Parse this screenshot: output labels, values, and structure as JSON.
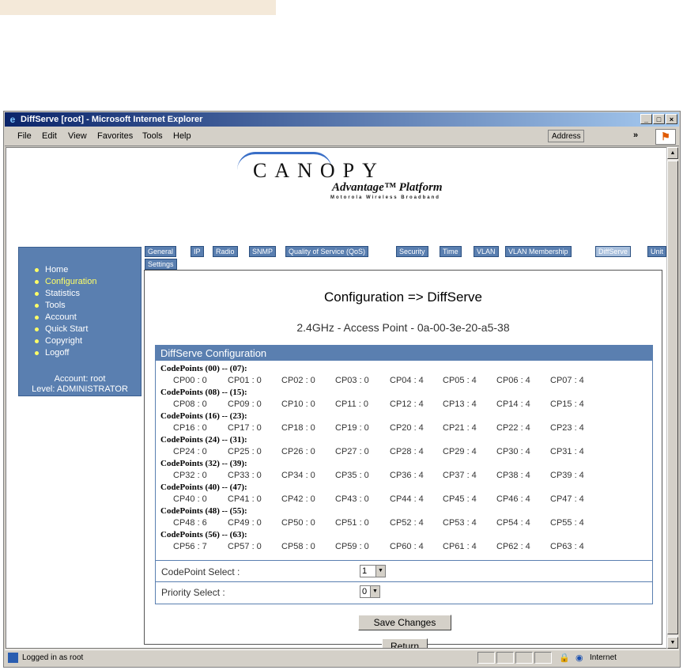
{
  "window": {
    "title": "DiffServe [root] - Microsoft Internet Explorer",
    "controls": [
      "_",
      "□",
      "×"
    ]
  },
  "menu": {
    "items": [
      "File",
      "Edit",
      "View",
      "Favorites",
      "Tools",
      "Help"
    ],
    "address_label": "Address",
    "more": "»"
  },
  "logo": {
    "name": "CANOPY",
    "sub": "Advantage™ Platform",
    "tagline": "Motorola Wireless Broadband"
  },
  "sidebar": {
    "items": [
      {
        "label": "Home",
        "current": false
      },
      {
        "label": "Configuration",
        "current": true
      },
      {
        "label": "Statistics",
        "current": false
      },
      {
        "label": "Tools",
        "current": false
      },
      {
        "label": "Account",
        "current": false
      },
      {
        "label": "Quick Start",
        "current": false
      },
      {
        "label": "Copyright",
        "current": false
      },
      {
        "label": "Logoff",
        "current": false
      }
    ],
    "account_line": "Account: root",
    "level_line": "Level: ADMINISTRATOR"
  },
  "tabs": [
    {
      "label": "General",
      "active": false
    },
    {
      "label": "IP",
      "active": false
    },
    {
      "label": "Radio",
      "active": false
    },
    {
      "label": "SNMP",
      "active": false
    },
    {
      "label": "Quality of Service (QoS)",
      "active": false
    },
    {
      "label": "Security",
      "active": false
    },
    {
      "label": "Time",
      "active": false
    },
    {
      "label": "VLAN",
      "active": false
    },
    {
      "label": "VLAN Membership",
      "active": false
    },
    {
      "label": "DiffServe",
      "active": true
    },
    {
      "label": "Unit",
      "active": false
    },
    {
      "label": "Settings",
      "active": false
    }
  ],
  "page": {
    "title": "Configuration => DiffServe",
    "subtitle": "2.4GHz - Access Point - 0a-00-3e-20-a5-38"
  },
  "diffserve": {
    "heading": "DiffServe Configuration",
    "groups": [
      {
        "range": "CodePoints (00) -- (07):",
        "points": [
          "CP00 : 0",
          "CP01 : 0",
          "CP02 : 0",
          "CP03 : 0",
          "CP04 : 4",
          "CP05 : 4",
          "CP06 : 4",
          "CP07 : 4"
        ]
      },
      {
        "range": "CodePoints (08) -- (15):",
        "points": [
          "CP08 : 0",
          "CP09 : 0",
          "CP10 : 0",
          "CP11 : 0",
          "CP12 : 4",
          "CP13 : 4",
          "CP14 : 4",
          "CP15 : 4"
        ]
      },
      {
        "range": "CodePoints (16) -- (23):",
        "points": [
          "CP16 : 0",
          "CP17 : 0",
          "CP18 : 0",
          "CP19 : 0",
          "CP20 : 4",
          "CP21 : 4",
          "CP22 : 4",
          "CP23 : 4"
        ]
      },
      {
        "range": "CodePoints (24) -- (31):",
        "points": [
          "CP24 : 0",
          "CP25 : 0",
          "CP26 : 0",
          "CP27 : 0",
          "CP28 : 4",
          "CP29 : 4",
          "CP30 : 4",
          "CP31 : 4"
        ]
      },
      {
        "range": "CodePoints (32) -- (39):",
        "points": [
          "CP32 : 0",
          "CP33 : 0",
          "CP34 : 0",
          "CP35 : 0",
          "CP36 : 4",
          "CP37 : 4",
          "CP38 : 4",
          "CP39 : 4"
        ]
      },
      {
        "range": "CodePoints (40) -- (47):",
        "points": [
          "CP40 : 0",
          "CP41 : 0",
          "CP42 : 0",
          "CP43 : 0",
          "CP44 : 4",
          "CP45 : 4",
          "CP46 : 4",
          "CP47 : 4"
        ]
      },
      {
        "range": "CodePoints (48) -- (55):",
        "points": [
          "CP48 : 6",
          "CP49 : 0",
          "CP50 : 0",
          "CP51 : 0",
          "CP52 : 4",
          "CP53 : 4",
          "CP54 : 4",
          "CP55 : 4"
        ]
      },
      {
        "range": "CodePoints (56) -- (63):",
        "points": [
          "CP56 : 7",
          "CP57 : 0",
          "CP58 : 0",
          "CP59 : 0",
          "CP60 : 4",
          "CP61 : 4",
          "CP62 : 4",
          "CP63 : 4"
        ]
      }
    ],
    "codepoint_select_label": "CodePoint Select :",
    "codepoint_select_value": "1",
    "priority_select_label": "Priority Select :",
    "priority_select_value": "0"
  },
  "buttons": {
    "save": "Save Changes",
    "return": "Return"
  },
  "status": {
    "text": "Logged in as root",
    "zone": "Internet"
  },
  "colors": {
    "nav_blue": "#5a7fb0",
    "highlight_yellow": "#ffff66",
    "title_bar": "#0a246a"
  }
}
